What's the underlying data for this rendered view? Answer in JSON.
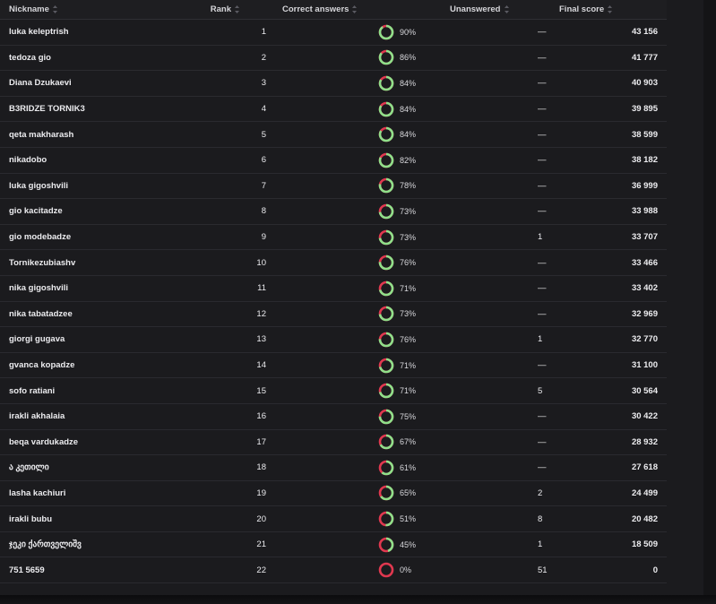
{
  "headers": {
    "nickname": "Nickname",
    "rank": "Rank",
    "correct": "Correct answers",
    "unanswered": "Unanswered",
    "final_score": "Final score"
  },
  "colors": {
    "correct": "#8fe08a",
    "wrong": "#e0384f"
  },
  "rows": [
    {
      "nickname": "luka keleptrish",
      "rank": "1",
      "correct_pct": "90%",
      "correct_value": 0.9,
      "unanswered": "—",
      "score": "43 156"
    },
    {
      "nickname": "tedoza gio",
      "rank": "2",
      "correct_pct": "86%",
      "correct_value": 0.86,
      "unanswered": "—",
      "score": "41 777"
    },
    {
      "nickname": "Diana Dzukaevi",
      "rank": "3",
      "correct_pct": "84%",
      "correct_value": 0.84,
      "unanswered": "—",
      "score": "40 903"
    },
    {
      "nickname": "B3RIDZE TORNIK3",
      "rank": "4",
      "correct_pct": "84%",
      "correct_value": 0.84,
      "unanswered": "—",
      "score": "39 895"
    },
    {
      "nickname": "qeta makharash",
      "rank": "5",
      "correct_pct": "84%",
      "correct_value": 0.84,
      "unanswered": "—",
      "score": "38 599"
    },
    {
      "nickname": "nikadobo",
      "rank": "6",
      "correct_pct": "82%",
      "correct_value": 0.82,
      "unanswered": "—",
      "score": "38 182"
    },
    {
      "nickname": "luka gigoshvili",
      "rank": "7",
      "correct_pct": "78%",
      "correct_value": 0.78,
      "unanswered": "—",
      "score": "36 999"
    },
    {
      "nickname": "gio kacitadze",
      "rank": "8",
      "correct_pct": "73%",
      "correct_value": 0.73,
      "unanswered": "—",
      "score": "33 988"
    },
    {
      "nickname": "gio modebadze",
      "rank": "9",
      "correct_pct": "73%",
      "correct_value": 0.73,
      "unanswered": "1",
      "score": "33 707"
    },
    {
      "nickname": "Tornikezubiashv",
      "rank": "10",
      "correct_pct": "76%",
      "correct_value": 0.76,
      "unanswered": "—",
      "score": "33 466"
    },
    {
      "nickname": "nika gigoshvili",
      "rank": "11",
      "correct_pct": "71%",
      "correct_value": 0.71,
      "unanswered": "—",
      "score": "33 402"
    },
    {
      "nickname": "nika tabatadzee",
      "rank": "12",
      "correct_pct": "73%",
      "correct_value": 0.73,
      "unanswered": "—",
      "score": "32 969"
    },
    {
      "nickname": "giorgi gugava",
      "rank": "13",
      "correct_pct": "76%",
      "correct_value": 0.76,
      "unanswered": "1",
      "score": "32 770"
    },
    {
      "nickname": "gvanca kopadze",
      "rank": "14",
      "correct_pct": "71%",
      "correct_value": 0.71,
      "unanswered": "—",
      "score": "31 100"
    },
    {
      "nickname": "sofo ratiani",
      "rank": "15",
      "correct_pct": "71%",
      "correct_value": 0.71,
      "unanswered": "5",
      "score": "30 564"
    },
    {
      "nickname": "irakli akhalaia",
      "rank": "16",
      "correct_pct": "75%",
      "correct_value": 0.75,
      "unanswered": "—",
      "score": "30 422"
    },
    {
      "nickname": "beqa vardukadze",
      "rank": "17",
      "correct_pct": "67%",
      "correct_value": 0.67,
      "unanswered": "—",
      "score": "28 932"
    },
    {
      "nickname": "ა კეთილი",
      "rank": "18",
      "correct_pct": "61%",
      "correct_value": 0.61,
      "unanswered": "—",
      "score": "27 618"
    },
    {
      "nickname": "lasha kachiuri",
      "rank": "19",
      "correct_pct": "65%",
      "correct_value": 0.65,
      "unanswered": "2",
      "score": "24 499"
    },
    {
      "nickname": "irakli bubu",
      "rank": "20",
      "correct_pct": "51%",
      "correct_value": 0.51,
      "unanswered": "8",
      "score": "20 482"
    },
    {
      "nickname": "ჯეკი ქართველიშვ",
      "rank": "21",
      "correct_pct": "45%",
      "correct_value": 0.45,
      "unanswered": "1",
      "score": "18 509"
    },
    {
      "nickname": "751 5659",
      "rank": "22",
      "correct_pct": "0%",
      "correct_value": 0.0,
      "unanswered": "51",
      "score": "0"
    }
  ]
}
